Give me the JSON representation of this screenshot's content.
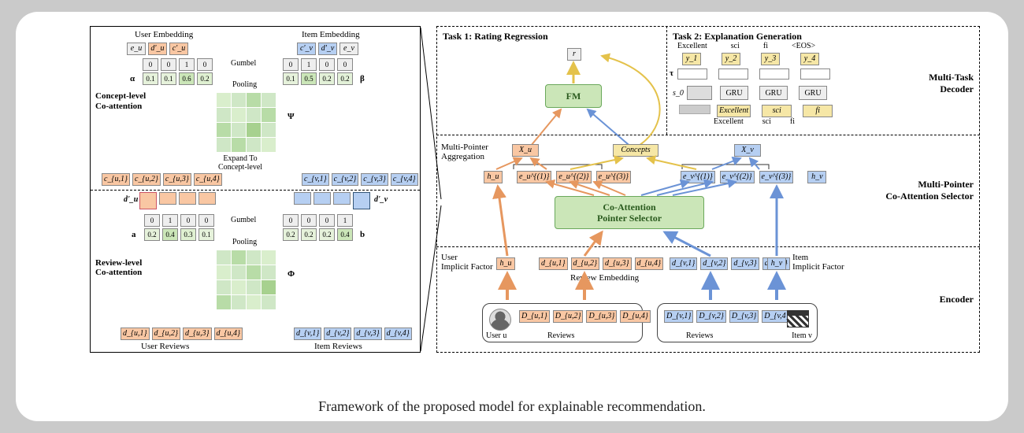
{
  "caption": "Framework of the proposed model for explainable recommendation.",
  "left": {
    "top": {
      "section": "Concept-level\nCo-attention",
      "userEmb": "User Embedding",
      "itemEmb": "Item Embedding",
      "eu": "e_u",
      "dpu": "d'_u",
      "cpu": "c'_u",
      "cpv": "c'_v",
      "dpv": "d'_v",
      "ev": "e_v",
      "gumbel": "Gumbel",
      "pooling": "Pooling",
      "alpha": "α",
      "beta": "β",
      "psi": "Ψ",
      "a_onehot": [
        "0",
        "0",
        "1",
        "0"
      ],
      "b_onehot": [
        "0",
        "1",
        "0",
        "0"
      ],
      "a_vals": [
        "0.1",
        "0.1",
        "0.6",
        "0.2"
      ],
      "b_vals": [
        "0.1",
        "0.5",
        "0.2",
        "0.2"
      ],
      "cuLabels": [
        "c_{u,1}",
        "c_{u,2}",
        "c_{u,3}",
        "c_{u,4}"
      ],
      "cvLabels": [
        "c_{v,1}",
        "c_{v,2}",
        "c_{v,3}",
        "c_{v,4}"
      ],
      "expand": "Expand To\nConcept-level"
    },
    "bot": {
      "section": "Review-level\nCo-attention",
      "a": "a",
      "b": "b",
      "phi": "Φ",
      "gumbel": "Gumbel",
      "pooling": "Pooling",
      "a_onehot": [
        "0",
        "1",
        "0",
        "0"
      ],
      "b_onehot": [
        "0",
        "0",
        "0",
        "1"
      ],
      "a_vals": [
        "0.2",
        "0.4",
        "0.3",
        "0.1"
      ],
      "b_vals": [
        "0.2",
        "0.2",
        "0.2",
        "0.4"
      ],
      "dpu": "d'_u",
      "dpv": "d'_v",
      "duLabels": [
        "d_{u,1}",
        "d_{u,2}",
        "d_{u,3}",
        "d_{u,4}"
      ],
      "dvLabels": [
        "d_{v,1}",
        "d_{v,2}",
        "d_{v,3}",
        "d_{v,4}"
      ],
      "userRev": "User Reviews",
      "itemRev": "Item Reviews"
    }
  },
  "right": {
    "task1": "Task 1: Rating Regression",
    "task2": "Task 2: Explanation Generation",
    "decoderTitle": "Multi-Task\nDecoder",
    "selectorTitle": "Multi-Pointer\nCo-Attention Selector",
    "encoderTitle": "Encoder",
    "mpAgg": "Multi-Pointer\nAggregation",
    "userImp": "User\nImplicit Factor",
    "itemImp": "Item\nImplicit Factor",
    "revEmb": "Review  Embedding",
    "fm": "FM",
    "r": "r",
    "coSel": "Co-Attention\nPointer Selector",
    "concepts": "Concepts",
    "Xu": "X_u",
    "Xv": "X_v",
    "hu": "h_u",
    "hv": "h_v",
    "euList": [
      "e_u^{(1)}",
      "e_u^{(2)}",
      "e_u^{(3)}"
    ],
    "evList": [
      "e_v^{(1)}",
      "e_v^{(2)}",
      "e_v^{(3)}"
    ],
    "gru": "GRU",
    "s0": "s_0",
    "tau": "τ",
    "outLabels": [
      "Excellent",
      "sci",
      "fi",
      "<EOS>"
    ],
    "inLabels": [
      "Excellent",
      "sci",
      "fi"
    ],
    "yLabels": [
      "y_1",
      "y_2",
      "y_3",
      "y_4"
    ],
    "userU": "User u",
    "itemV": "Item v",
    "reviews": "Reviews",
    "DuLabels": [
      "D_{u,1}",
      "D_{u,2}",
      "D_{u,3}",
      "D_{u,4}"
    ],
    "DvLabels": [
      "D_{v,1}",
      "D_{v,2}",
      "D_{v,3}",
      "D_{v,4}"
    ],
    "duLabels": [
      "d_{u,1}",
      "d_{u,2}",
      "d_{u,3}",
      "d_{u,4}"
    ],
    "dvLabels": [
      "d_{v,1}",
      "d_{v,2}",
      "d_{v,3}",
      "d_{v,4}"
    ]
  }
}
